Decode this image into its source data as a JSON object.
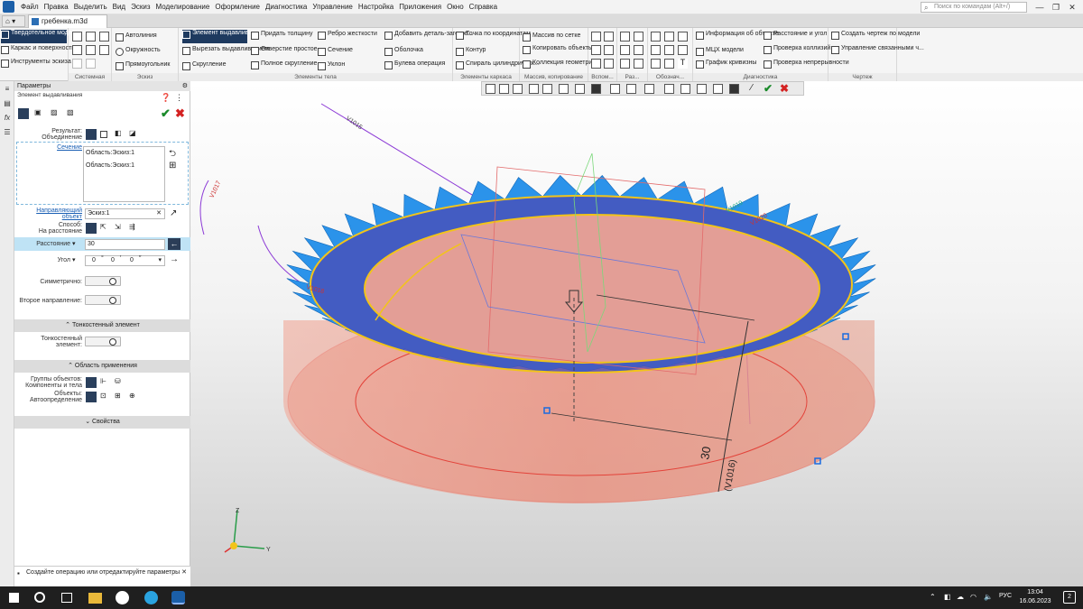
{
  "menubar": {
    "items": [
      "Файл",
      "Правка",
      "Выделить",
      "Вид",
      "Эскиз",
      "Моделирование",
      "Оформление",
      "Диагностика",
      "Управление",
      "Настройка",
      "Приложения",
      "Окно",
      "Справка"
    ],
    "search_placeholder": "Поиск по командам (Alt+/)"
  },
  "tabs": {
    "home": "⌂",
    "document": "гребенка.m3d"
  },
  "ribbon": {
    "mode": {
      "line1": "Твердотельное моделирование",
      "item2": "Каркас и поверхности",
      "item3": "Инструменты эскиза"
    },
    "groups": {
      "system": "Системная",
      "sketch": "Эскиз",
      "body": "Элементы тела",
      "frame": "Элементы каркаса",
      "array": "Массив, копирование",
      "aux": "Вспом...",
      "size": "Раз...",
      "notation": "Обознач...",
      "diag": "Диагностика",
      "drawing": "Чертеж"
    },
    "sketch_buttons": [
      "Автолиния",
      "Окружность",
      "Прямоугольник"
    ],
    "body_col1": [
      "Элемент выдавливания",
      "Вырезать выдавливанием",
      "Скругление"
    ],
    "body_col2": [
      "Придать толщину",
      "Отверстие простое",
      "Полное скругление"
    ],
    "body_col3": [
      "Ребро жесткости",
      "Сечение",
      "Уклон"
    ],
    "body_col4": [
      "Добавить деталь-заготов...",
      "Оболочка",
      "Булева операция"
    ],
    "frame_col": [
      "Точка по координатам",
      "Контур",
      "Спираль цилиндрическ..."
    ],
    "array_col": [
      "Массив по сетке",
      "Копировать объекты",
      "Коллекция геометрии"
    ],
    "diag_col1": [
      "Информация об объекте",
      "МЦХ модели",
      "График кривизны"
    ],
    "diag_col2": [
      "Расстояние и угол",
      "Проверка коллизий",
      "Проверка непрерывности"
    ],
    "drawing_col": [
      "Создать чертеж по модели",
      "Управление связанными ч..."
    ]
  },
  "panel": {
    "title": "Параметры",
    "subtitle": "Элемент выдавливания",
    "result_label": "Результат:\nОбъединение",
    "section_label": "Сечение",
    "section_items": [
      "Область:Эскиз:1",
      "Область:Эскиз:1"
    ],
    "direction_label": "Направляющий\nобъект",
    "direction_value": "Эскиз:1",
    "method_label": "Способ:\nНа расстояние",
    "distance_label": "Расстояние",
    "distance_value": "30",
    "angle_label": "Угол",
    "angle_deg": "0",
    "angle_min": "0",
    "angle_sec": "0",
    "symmetric_label": "Симметрично:",
    "second_dir_label": "Второе направление:",
    "thin_section": "Тонкостенный элемент",
    "thin_label": "Тонкостенный\nэлемент:",
    "scope_section": "Область применения",
    "groups_label": "Группы объектов:\nКомпоненты и тела",
    "objects_label": "Объекты:\nАвтоопределение",
    "props_section": "Свойства",
    "hint": "Создайте операцию или отредактируйте параметры"
  },
  "viewport": {
    "dimension_value": "30",
    "dimension_tag": "(V1016)",
    "label_v1": "V1015",
    "label_v2": "V1017",
    "label_v3": "V1018",
    "label_v4": "V1019",
    "label_v5": "V1020",
    "axis_z": "Z",
    "axis_y": "Y"
  },
  "taskbar": {
    "lang": "РУС",
    "time": "13:04",
    "date": "16.06.2023",
    "notifications": "2"
  },
  "colors": {
    "ring_fill": "#e8806e",
    "teeth": "#1f8fe8",
    "edge": "#f2c419",
    "accent": "#1e3a5f"
  }
}
